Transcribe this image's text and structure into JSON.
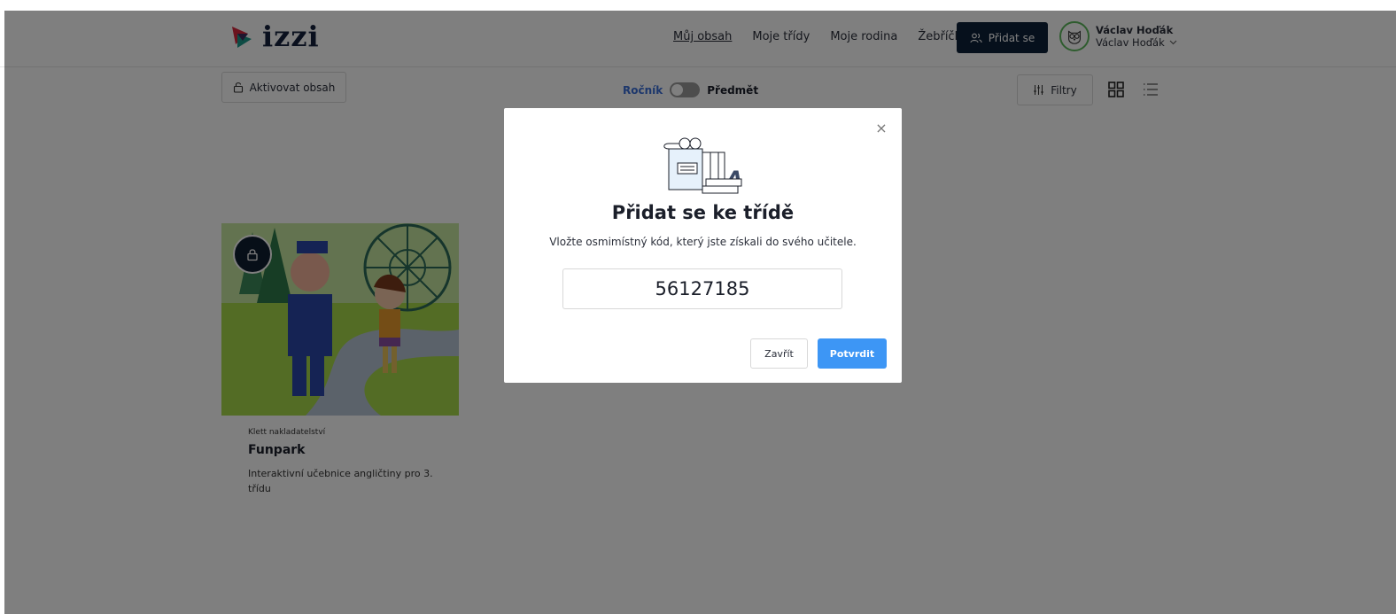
{
  "app": {
    "logo_text": "izzi"
  },
  "nav": {
    "items": [
      {
        "label": "Můj obsah",
        "active": true
      },
      {
        "label": "Moje třídy"
      },
      {
        "label": "Moje rodina"
      },
      {
        "label": "Žebříčky"
      }
    ],
    "join_label": "Přidat se"
  },
  "user": {
    "name": "Václav Hoďák",
    "subname": "Václav Hoďák"
  },
  "toolbar": {
    "activate_label": "Aktivovat obsah",
    "toggle_left": "Ročník",
    "toggle_right": "Předmět",
    "filters_label": "Filtry"
  },
  "product": {
    "publisher": "Klett nakladatelství",
    "title": "Funpark",
    "description": "Interaktivní učebnice angličtiny pro 3. třídu"
  },
  "modal": {
    "title": "Přidat se ke třídě",
    "text": "Vložte osmimístný kód, který jste získali do svého učitele.",
    "code_value": "56127185",
    "close_label": "Zavřít",
    "confirm_label": "Potvrdit",
    "close_icon": "×"
  },
  "colors": {
    "primary_dark": "#0d2038",
    "accent_blue": "#3d96f5",
    "toggle_active": "#3a6fd8",
    "avatar_border": "#5cb85c"
  }
}
